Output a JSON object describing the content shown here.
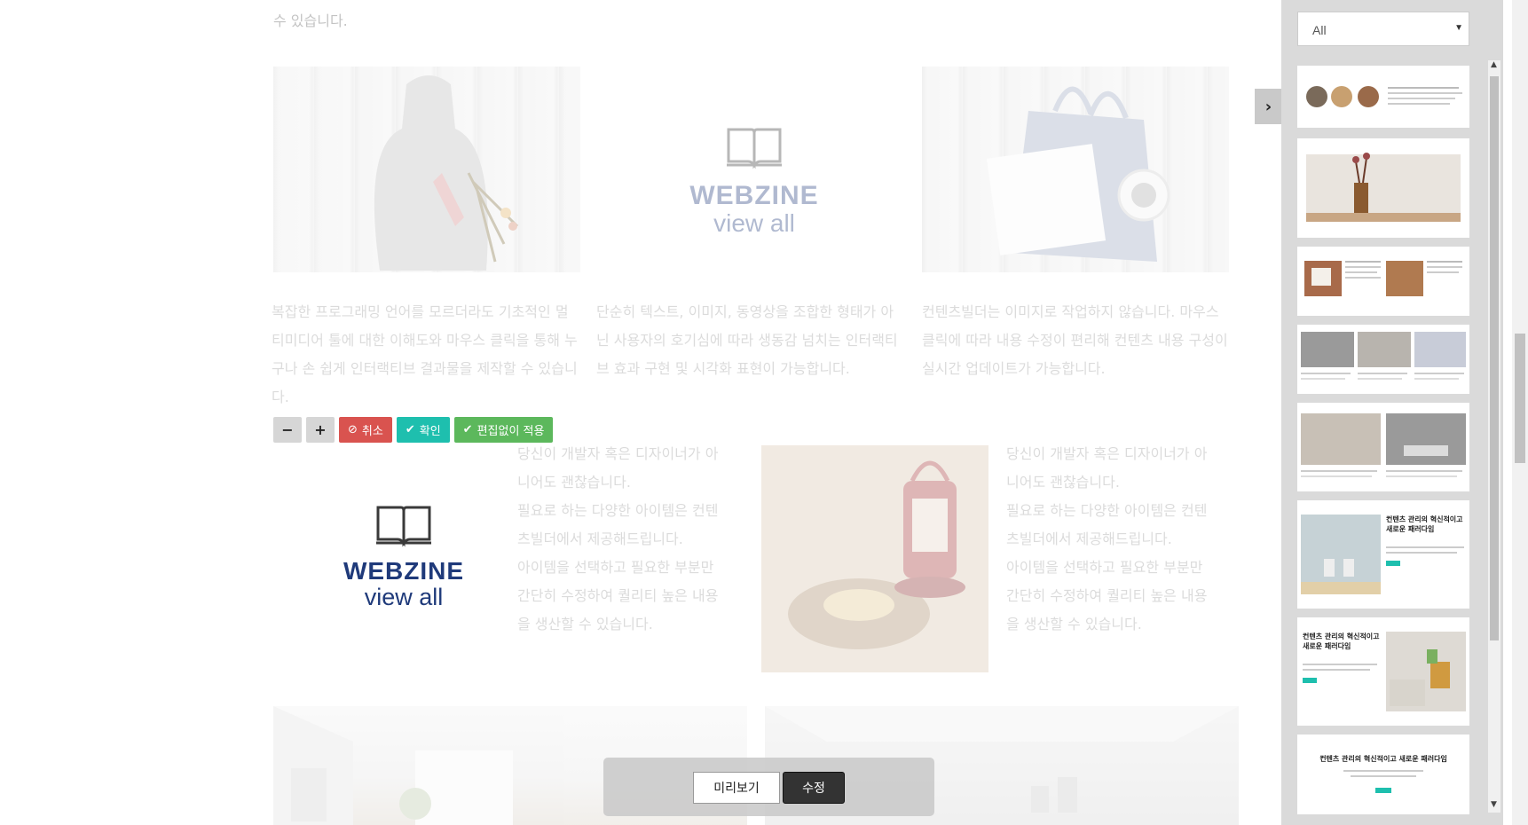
{
  "content": {
    "top_fragment": "수 있습니다.",
    "row1": {
      "paragraphs": [
        "복잡한 프로그래밍 언어를 모르더라도 기초적인 멀티미디어 툴에 대한 이해도와 마우스 클릭을 통해 누구나 손 쉽게 인터랙티브 결과물을 제작할 수 있습니다.",
        "단순히 텍스트, 이미지, 동영상을 조합한 형태가 아닌 사용자의 호기심에 따라 생동감 넘치는 인터랙티브 효과 구현 및 시각화 표현이 가능합니다.",
        "컨텐츠빌더는 이미지로 작업하지 않습니다. 마우스 클릭에 따라 내용 수정이 편리해 컨텐츠 내용 구성이 실시간 업데이트가 가능합니다."
      ]
    },
    "webzine": {
      "title": "WEBZINE",
      "subtitle": "view all"
    },
    "row2": {
      "left_text": "당신이 개발자 혹은 디자이너가 아니어도 괜찮습니다.\n필요로 하는 다양한 아이템은 컨텐츠빌더에서 제공해드립니다.\n아이템을 선택하고 필요한 부분만 간단히 수정하여 퀄리티 높은 내용을 생산할 수 있습니다.",
      "right_text": "당신이 개발자 혹은 디자이너가 아니어도 괜찮습니다.\n필요로 하는 다양한 아이템은 컨텐츠빌더에서 제공해드립니다.\n아이템을 선택하고 필요한 부분만 간단히 수정하여 퀄리티 높은 내용을 생산할 수 있습니다."
    }
  },
  "toolbar": {
    "minus": "−",
    "plus": "+",
    "cancel": "취소",
    "confirm": "확인",
    "apply_no_edit": "편집없이 적용"
  },
  "bottom_bar": {
    "preview": "미리보기",
    "edit": "수정"
  },
  "panel": {
    "filter_value": "All",
    "toggle_icon": "chevron-right-icon",
    "thumb_text_1": "컨텐츠 관리의 혁신적이고 새로운 패러다임",
    "thumb_text_2": "컨텐츠 관리의 혁신적이고 새로운 패러다임",
    "thumb_text_3": "컨텐츠 관리의 혁신적이고 새로운 패러다임"
  },
  "colors": {
    "cancel": "#d9534f",
    "confirm": "#1ebfae",
    "apply": "#5cb85c",
    "webzine_navy": "#1f3a7a"
  }
}
